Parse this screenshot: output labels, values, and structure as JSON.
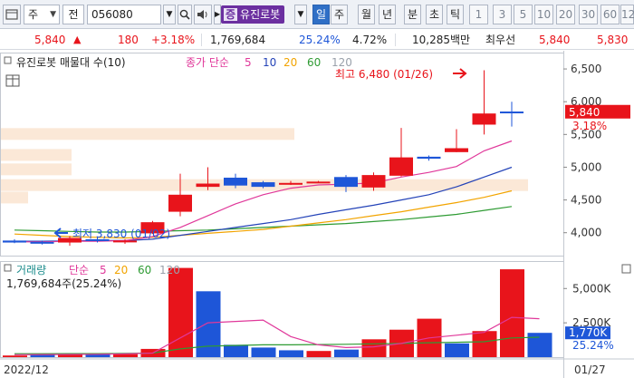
{
  "toolbar": {
    "market_label": "주",
    "period_label": "전",
    "code": "056080",
    "stock_tag": "증",
    "stock_name": "유진로봇",
    "periods": [
      "일",
      "주",
      "월",
      "년",
      "분",
      "초",
      "틱"
    ],
    "numbers": [
      "1",
      "3",
      "5",
      "10",
      "20",
      "30",
      "60",
      "12"
    ]
  },
  "quote": {
    "price": "5,840",
    "change": "180",
    "change_pct": "+3.18%",
    "volume": "1,769,684",
    "vol_ratio": "25.24%",
    "turnover": "4.72%",
    "amount": "10,285백만",
    "priority_label": "최우선",
    "ask": "5,840",
    "bid": "5,830"
  },
  "colors": {
    "up": "#e8141b",
    "down": "#1e56d8",
    "ma5": "#e0389a",
    "ma10": "#2443b8",
    "ma20": "#f2a400",
    "ma60": "#2e9b33",
    "ma120": "#9aa1ab"
  },
  "price_panel": {
    "title": "유진로봇 매물대 수(10)",
    "ma_label": "종가 단순",
    "ma_periods": [
      "5",
      "10",
      "20",
      "60",
      "120"
    ],
    "y_ticks": [
      "6,500",
      "6,000",
      "5,500",
      "5,000",
      "4,500",
      "4,000"
    ],
    "current_price": "5,840",
    "current_pct": "3.18%",
    "high_note": "최고 6,480 (01/26)",
    "low_note": "최저 3,830 (01/02)"
  },
  "volume_panel": {
    "title": "거래량",
    "ma_label": "단순",
    "ma_periods": [
      "5",
      "20",
      "60",
      "120"
    ],
    "value_text": "1,769,684주(25.24%)",
    "y_ticks": [
      "5,000K",
      "2,500K"
    ],
    "current_vol": "1,770K",
    "current_pct": "25.24%"
  },
  "x_axis": {
    "left_label": "2022/12",
    "right_label": "01/27"
  },
  "chart_data": {
    "type": "candlestick",
    "price_range": [
      3650,
      6750
    ],
    "candles": [
      {
        "o": 3880,
        "h": 3900,
        "l": 3840,
        "c": 3850
      },
      {
        "o": 3860,
        "h": 3880,
        "l": 3820,
        "c": 3840
      },
      {
        "o": 3850,
        "h": 3950,
        "l": 3800,
        "c": 3920
      },
      {
        "o": 3900,
        "h": 3940,
        "l": 3850,
        "c": 3880
      },
      {
        "o": 3860,
        "h": 3900,
        "l": 3830,
        "c": 3880
      },
      {
        "o": 3990,
        "h": 4180,
        "l": 3980,
        "c": 4160
      },
      {
        "o": 4320,
        "h": 4900,
        "l": 4250,
        "c": 4580
      },
      {
        "o": 4700,
        "h": 5000,
        "l": 4650,
        "c": 4750
      },
      {
        "o": 4840,
        "h": 4900,
        "l": 4680,
        "c": 4720
      },
      {
        "o": 4770,
        "h": 4790,
        "l": 4680,
        "c": 4700
      },
      {
        "o": 4740,
        "h": 4790,
        "l": 4730,
        "c": 4760
      },
      {
        "o": 4770,
        "h": 4790,
        "l": 4760,
        "c": 4780
      },
      {
        "o": 4850,
        "h": 4880,
        "l": 4620,
        "c": 4700
      },
      {
        "o": 4690,
        "h": 4920,
        "l": 4640,
        "c": 4880
      },
      {
        "o": 4870,
        "h": 5600,
        "l": 4860,
        "c": 5150
      },
      {
        "o": 5160,
        "h": 5180,
        "l": 5100,
        "c": 5130
      },
      {
        "o": 5230,
        "h": 5580,
        "l": 5230,
        "c": 5290
      },
      {
        "o": 5650,
        "h": 6480,
        "l": 5500,
        "c": 5820
      },
      {
        "o": 5850,
        "h": 6000,
        "l": 5620,
        "c": 5840
      }
    ],
    "ma5": [
      3860,
      3860,
      3870,
      3870,
      3880,
      3940,
      4080,
      4260,
      4440,
      4580,
      4680,
      4730,
      4740,
      4760,
      4850,
      4920,
      5010,
      5250,
      5400
    ],
    "ma10": [
      3870,
      3870,
      3875,
      3880,
      3880,
      3900,
      3960,
      4020,
      4080,
      4140,
      4200,
      4280,
      4350,
      4420,
      4500,
      4580,
      4700,
      4850,
      5000
    ],
    "ma20": [
      3980,
      3960,
      3940,
      3930,
      3920,
      3930,
      3960,
      3990,
      4020,
      4050,
      4100,
      4150,
      4200,
      4260,
      4320,
      4390,
      4460,
      4540,
      4640
    ],
    "ma60": [
      4040,
      4030,
      4020,
      4010,
      4010,
      4020,
      4030,
      4040,
      4060,
      4080,
      4100,
      4120,
      4140,
      4170,
      4200,
      4240,
      4280,
      4340,
      4400
    ],
    "volume_range": [
      0,
      7000000
    ],
    "volume": [
      120000,
      180000,
      260000,
      200000,
      220000,
      600000,
      6500000,
      4800000,
      900000,
      700000,
      500000,
      450000,
      550000,
      1300000,
      2000000,
      2800000,
      1000000,
      1900000,
      6400000,
      1769684
    ],
    "vol_up": [
      true,
      false,
      true,
      false,
      true,
      true,
      true,
      false,
      false,
      false,
      false,
      true,
      false,
      true,
      true,
      true,
      false,
      true,
      true,
      false
    ],
    "vol_ma5": [
      180000,
      190000,
      200000,
      210000,
      240000,
      300000,
      1400000,
      2500000,
      2600000,
      2700000,
      1500000,
      900000,
      700000,
      750000,
      1000000,
      1400000,
      1600000,
      1800000,
      2900000,
      2800000
    ],
    "vol_ma20": [
      250000,
      250000,
      260000,
      260000,
      270000,
      300000,
      600000,
      800000,
      850000,
      900000,
      900000,
      920000,
      940000,
      970000,
      1000000,
      1050000,
      1080000,
      1120000,
      1400000,
      1450000
    ],
    "volume_profile": [
      {
        "price": 5500,
        "width": 0.54
      },
      {
        "price": 5180,
        "width": 0.13
      },
      {
        "price": 4960,
        "width": 0.13
      },
      {
        "price": 4720,
        "width": 0.97
      },
      {
        "price": 4530,
        "width": 0.05
      }
    ]
  }
}
